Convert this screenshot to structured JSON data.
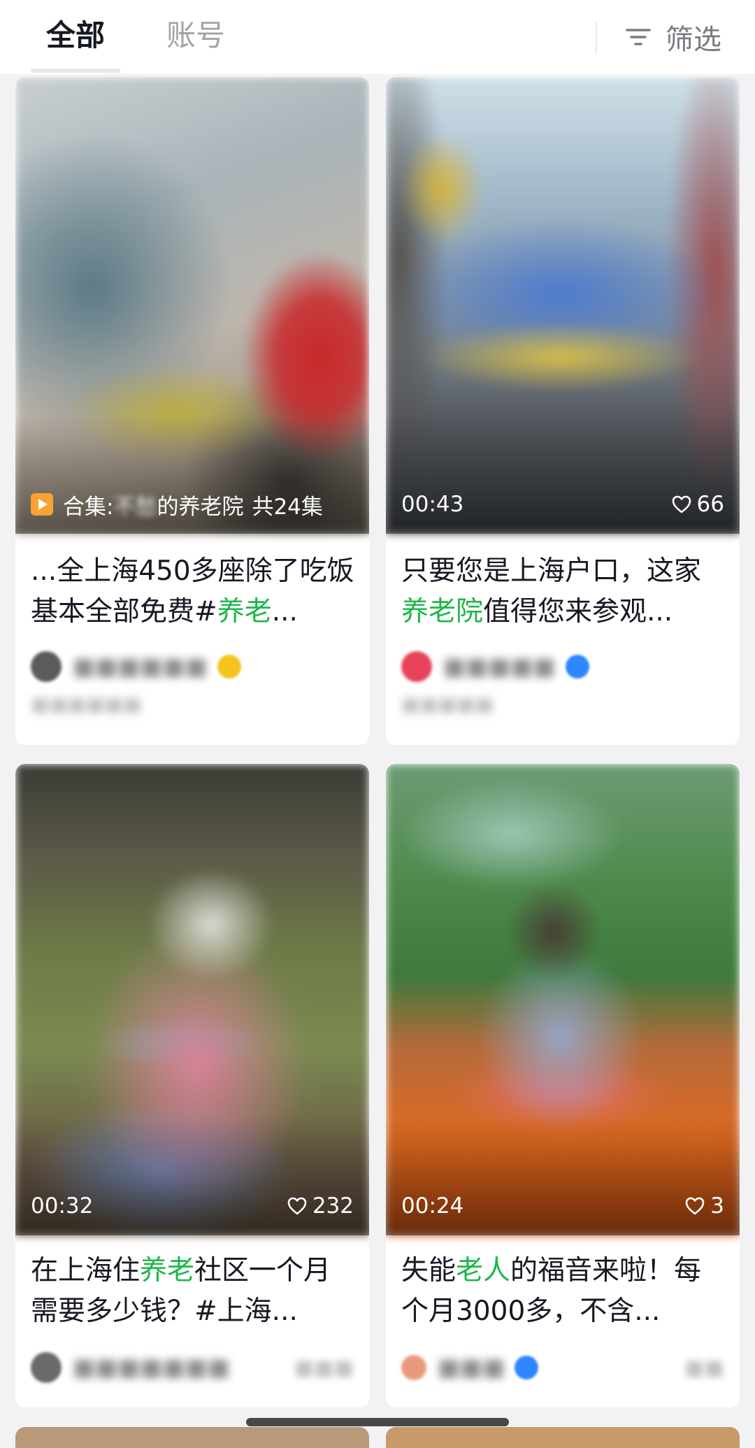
{
  "tabs": {
    "all": "全部",
    "account": "账号"
  },
  "filter": {
    "label": "筛选",
    "icon": "filter-icon"
  },
  "cards": [
    {
      "overlay": {
        "collection_prefix": "合集:",
        "collection_blurred": "不愁",
        "collection_name": "的养老院",
        "collection_count": "共24集"
      },
      "title_parts": [
        "...全上海450多座除了吃饭基本全部免费#",
        "养老",
        "..."
      ],
      "author_avatar_color": "#5b5b5b",
      "verify_color": "#f5c31d"
    },
    {
      "overlay": {
        "duration": "00:43",
        "likes": "66"
      },
      "title_parts": [
        "只要您是上海户口，这家",
        "养老院",
        "值得您来参观..."
      ],
      "author_avatar_color": "#e8435a",
      "verify_color": "#2f86ff"
    },
    {
      "overlay": {
        "duration": "00:32",
        "likes": "232"
      },
      "title_parts": [
        "在上海住",
        "养老",
        "社区一个月需要多少钱？#上海..."
      ],
      "author_avatar_color": "#6a6a6a",
      "verify_color": ""
    },
    {
      "overlay": {
        "duration": "00:24",
        "likes": "3"
      },
      "title_parts": [
        "失能",
        "老人",
        "的福音来啦！每个月3000多，不含..."
      ],
      "author_avatar_color": "#e79a7a",
      "verify_color": "#2f86ff"
    }
  ],
  "colors": {
    "highlight": "#1fb74a",
    "text": "#161823",
    "muted": "#a2a3a7"
  }
}
